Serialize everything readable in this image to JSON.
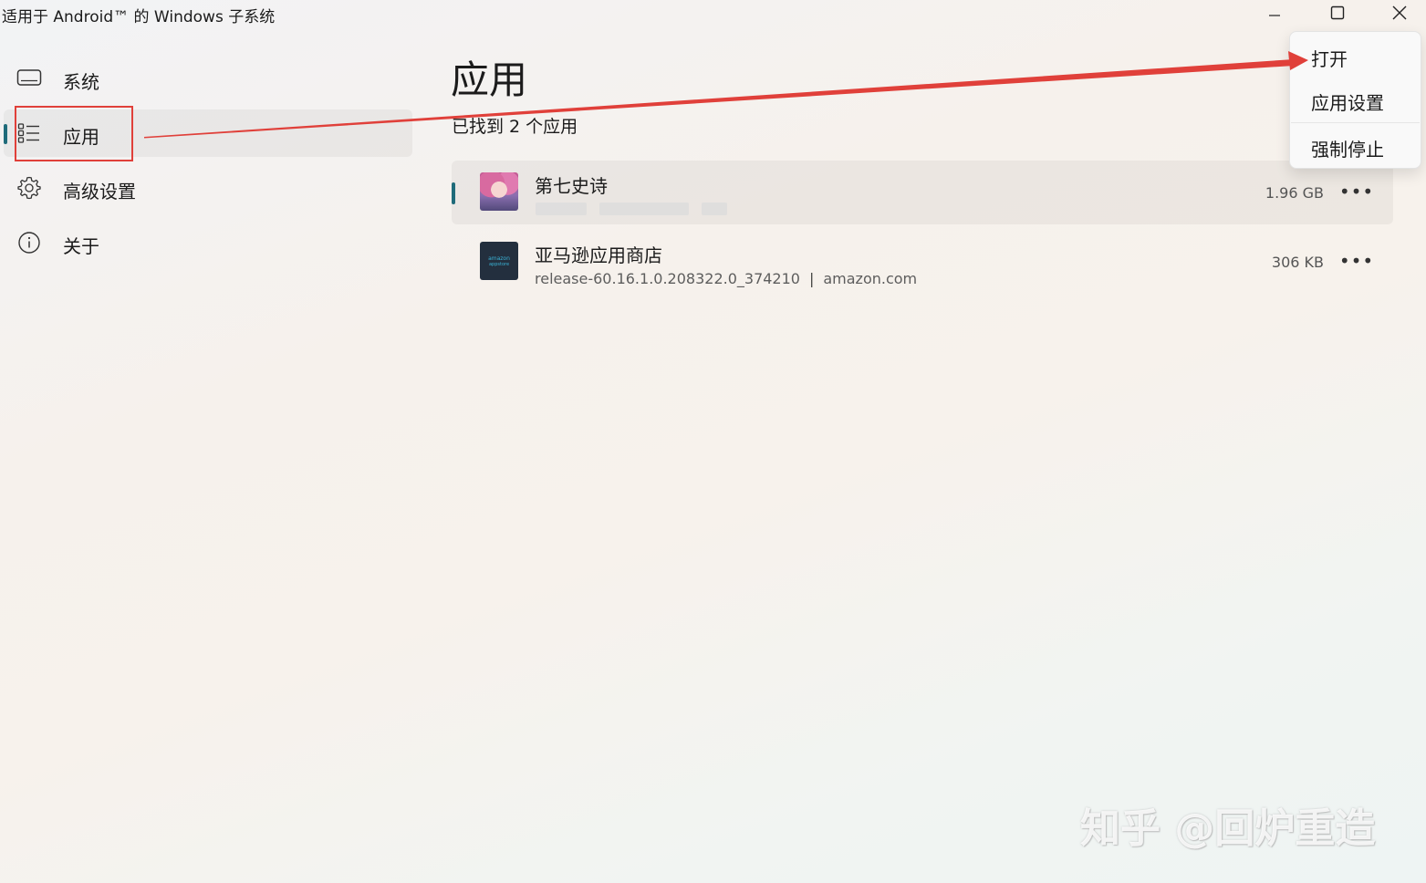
{
  "window": {
    "title": "适用于 Android™ 的 Windows 子系统",
    "minimize_icon": "minimize-icon",
    "maximize_icon": "maximize-icon",
    "close_icon": "close-icon"
  },
  "sidebar": {
    "items": [
      {
        "label": "系统",
        "icon": "monitor-icon",
        "active": false
      },
      {
        "label": "应用",
        "icon": "list-icon",
        "active": true
      },
      {
        "label": "高级设置",
        "icon": "gear-icon",
        "active": false
      },
      {
        "label": "关于",
        "icon": "info-icon",
        "active": false
      }
    ]
  },
  "main": {
    "title": "应用",
    "found_count": "已找到 2 个应用",
    "apps": [
      {
        "name": "第七史诗",
        "size": "1.96 GB",
        "more": "•••",
        "selected": true
      },
      {
        "name": "亚马逊应用商店",
        "version": "release-60.16.1.0.208322.0_374210",
        "separator": "|",
        "publisher": "amazon.com",
        "size": "306 KB",
        "more": "•••",
        "icon_text_1": "amazon",
        "icon_text_2": "appstore",
        "selected": false
      }
    ]
  },
  "context_menu": {
    "items": [
      "打开",
      "应用设置",
      "强制停止"
    ]
  },
  "annotation": {
    "color": "#e0403a"
  },
  "watermark": "知乎 @回炉重造",
  "colors": {
    "accent": "#1f6b7a",
    "annotation": "#e0403a"
  }
}
